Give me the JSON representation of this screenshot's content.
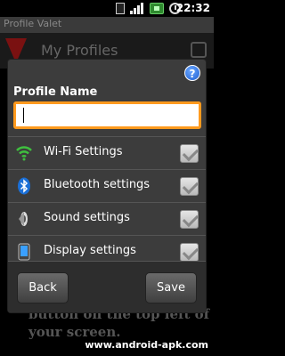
{
  "status_bar": {
    "time": "22:32"
  },
  "app": {
    "title": "Profile Valet",
    "screen_title": "My Profiles",
    "bg_lines": [
      "button on the top left of",
      "your screen."
    ]
  },
  "dialog": {
    "title": "Profile Name",
    "name_input": {
      "value": "",
      "placeholder": ""
    },
    "settings": [
      {
        "label": "Wi-Fi Settings",
        "icon": "wifi-icon",
        "checked": true
      },
      {
        "label": "Bluetooth settings",
        "icon": "bluetooth-icon",
        "checked": true
      },
      {
        "label": "Sound settings",
        "icon": "speaker-icon",
        "checked": true
      },
      {
        "label": "Display settings",
        "icon": "phone-display-icon",
        "checked": true
      }
    ],
    "buttons": {
      "back": "Back",
      "save": "Save"
    }
  },
  "watermark": "www.android-apk.com",
  "colors": {
    "input_border": "#ff9a1e",
    "dialog_bg": "#3c3c3c",
    "help_blue": "#1f5fd0"
  }
}
